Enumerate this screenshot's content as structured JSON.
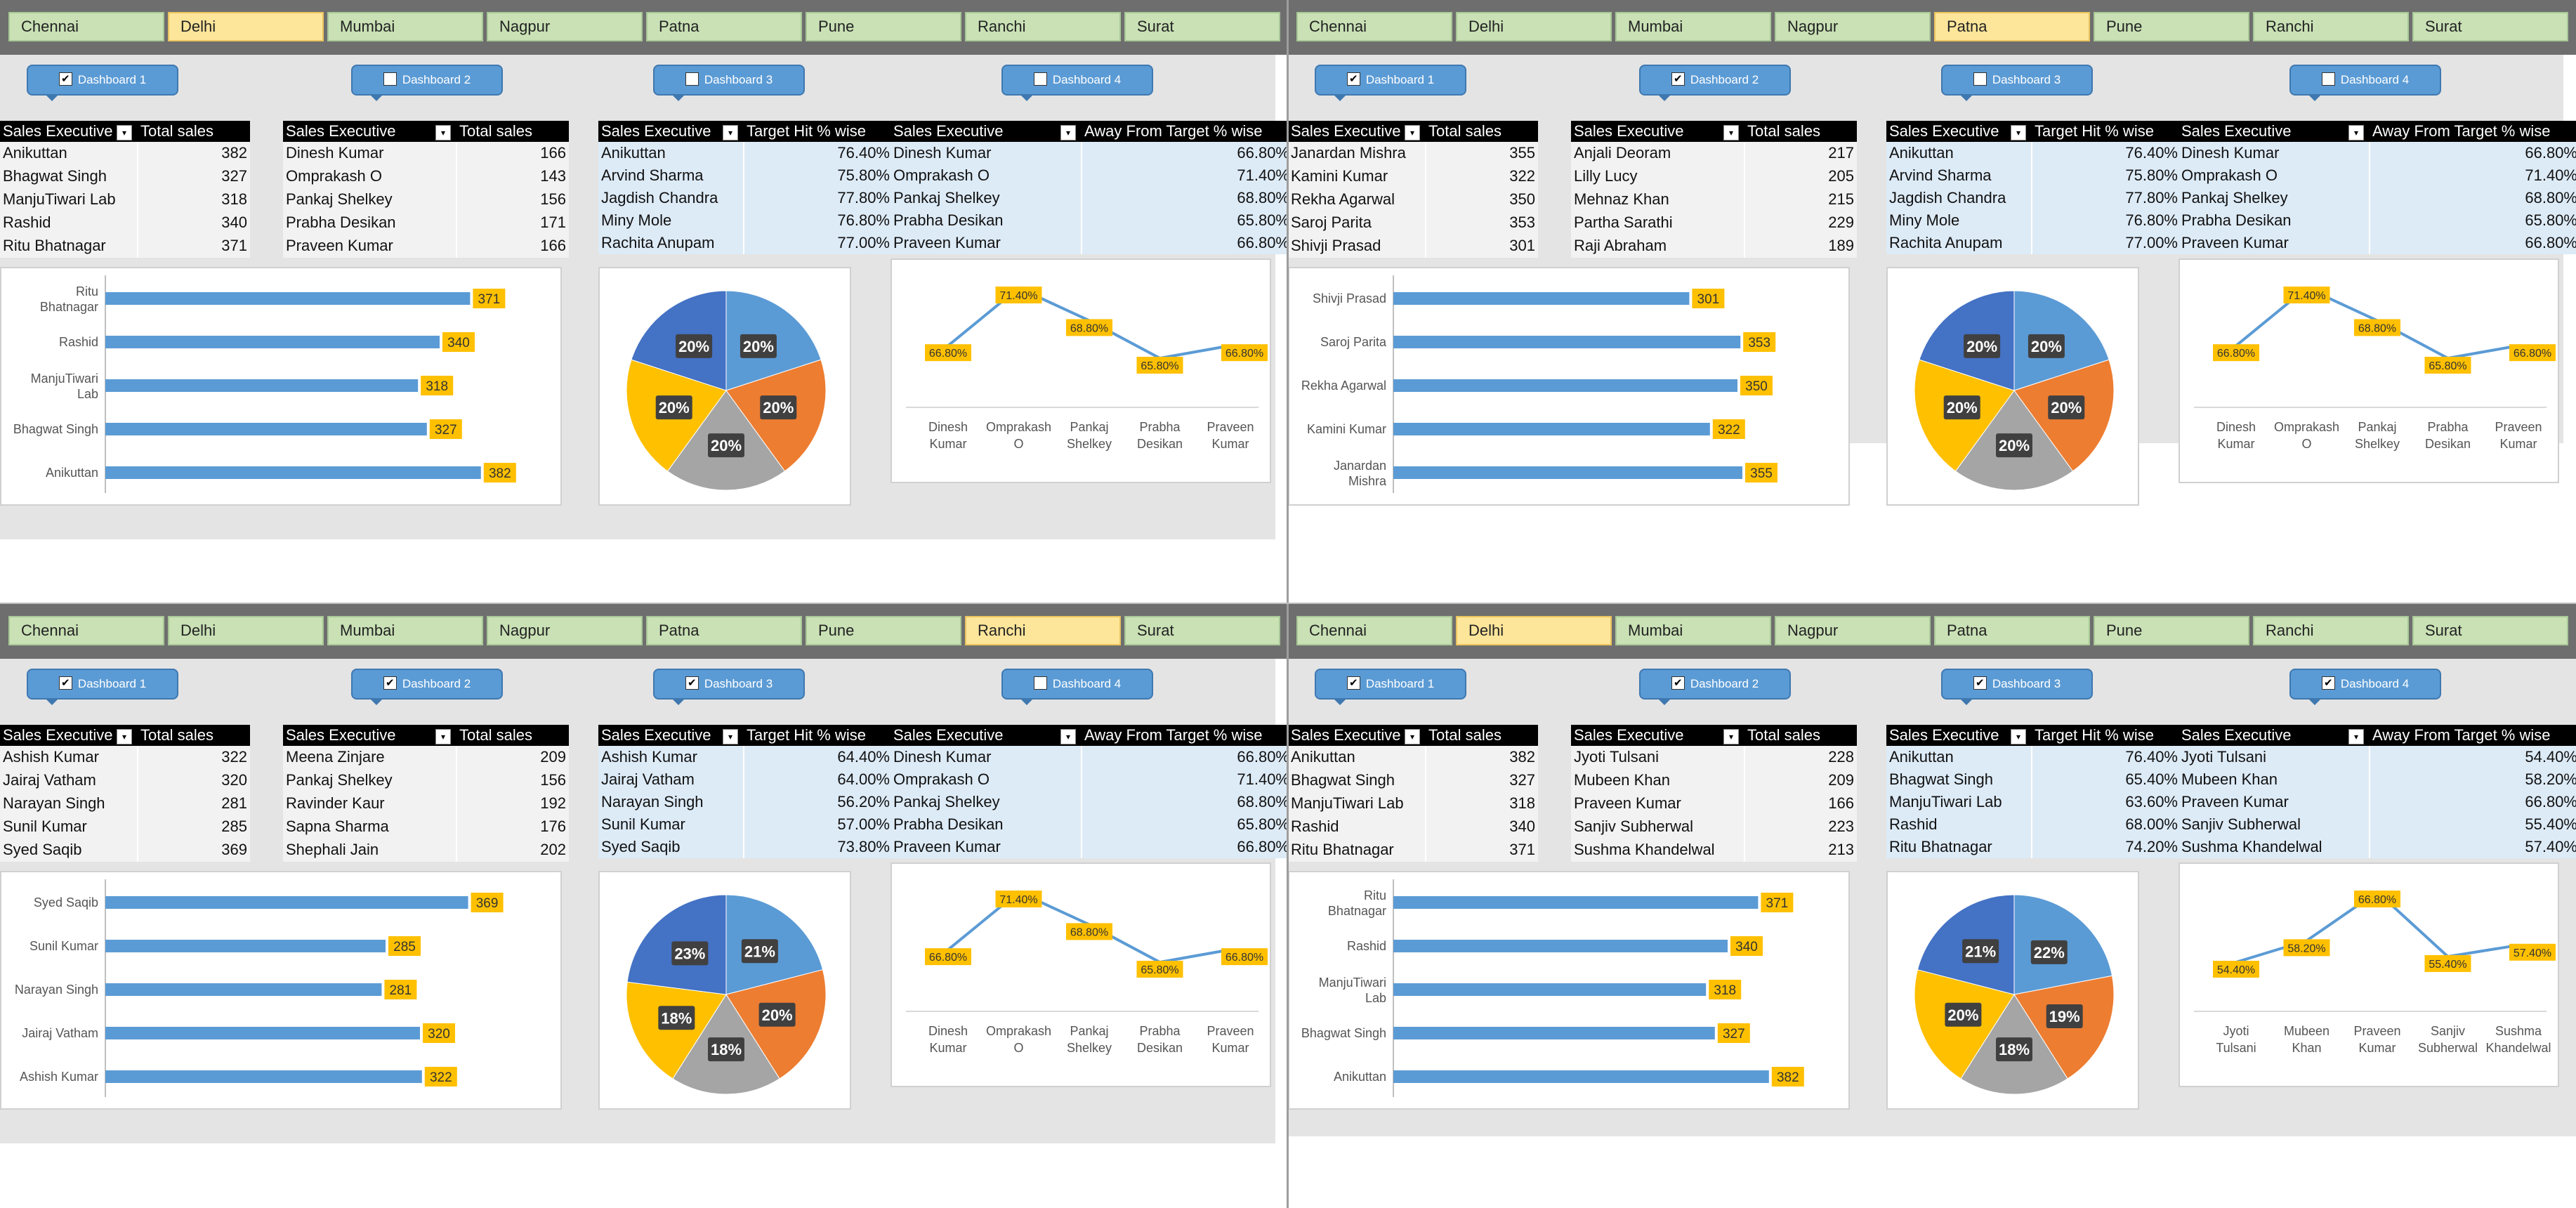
{
  "quadrants": [
    {
      "id": "q1",
      "cities": [
        "Chennai",
        "Delhi",
        "Mumbai",
        "Nagpur",
        "Patna",
        "Pune",
        "Ranchi",
        "Surat"
      ],
      "selected_city": "Delhi",
      "dashboards": [
        {
          "label": "Dashboard 1",
          "checked": true
        },
        {
          "label": "Dashboard 2",
          "checked": false
        },
        {
          "label": "Dashboard 3",
          "checked": false
        },
        {
          "label": "Dashboard 4",
          "checked": false
        }
      ],
      "tables": [
        {
          "h1": "Sales Executive",
          "h2": "Total sales",
          "rows": [
            [
              "Anikuttan",
              "382"
            ],
            [
              "Bhagwat Singh",
              "327"
            ],
            [
              "ManjuTiwari Lab",
              "318"
            ],
            [
              "Rashid",
              "340"
            ],
            [
              "Ritu Bhatnagar",
              "371"
            ]
          ]
        },
        {
          "h1": "Sales Executive",
          "h2": "Total sales",
          "rows": [
            [
              "Dinesh Kumar",
              "166"
            ],
            [
              "Omprakash O",
              "143"
            ],
            [
              "Pankaj Shelkey",
              "156"
            ],
            [
              "Prabha Desikan",
              "171"
            ],
            [
              "Praveen Kumar",
              "166"
            ]
          ]
        },
        {
          "h1": "Sales Executive",
          "h2": "Target Hit % wise",
          "rows": [
            [
              "Anikuttan",
              "76.40%"
            ],
            [
              "Arvind Sharma",
              "75.80%"
            ],
            [
              "Jagdish Chandra",
              "77.80%"
            ],
            [
              "Miny Mole",
              "76.80%"
            ],
            [
              "Rachita Anupam",
              "77.00%"
            ]
          ]
        },
        {
          "h1": "Sales Executive",
          "h2": "Away From Target % wise",
          "rows": [
            [
              "Dinesh Kumar",
              "66.80%"
            ],
            [
              "Omprakash O",
              "71.40%"
            ],
            [
              "Pankaj Shelkey",
              "68.80%"
            ],
            [
              "Prabha Desikan",
              "65.80%"
            ],
            [
              "Praveen Kumar",
              "66.80%"
            ]
          ]
        }
      ],
      "bar_chart": {
        "categories": [
          "Ritu Bhatnagar",
          "Rashid",
          "ManjuTiwari Lab",
          "Bhagwat Singh",
          "Anikuttan"
        ],
        "values": [
          371,
          340,
          318,
          327,
          382
        ]
      },
      "pie_chart": {
        "values": [
          20,
          20,
          20,
          20,
          20
        ],
        "labels": [
          "20%",
          "20%",
          "20%",
          "20%",
          "20%"
        ]
      },
      "line_chart": {
        "categories": [
          "Dinesh Kumar",
          "Omprakash O",
          "Pankaj Shelkey",
          "Prabha Desikan",
          "Praveen Kumar"
        ],
        "values": [
          66.8,
          71.4,
          68.8,
          65.8,
          66.8
        ],
        "labels": [
          "66.80%",
          "71.40%",
          "68.80%",
          "65.80%",
          "66.80%"
        ]
      }
    },
    {
      "id": "q2",
      "cities": [
        "Chennai",
        "Delhi",
        "Mumbai",
        "Nagpur",
        "Patna",
        "Pune",
        "Ranchi",
        "Surat"
      ],
      "selected_city": "Patna",
      "dashboards": [
        {
          "label": "Dashboard 1",
          "checked": true
        },
        {
          "label": "Dashboard 2",
          "checked": true
        },
        {
          "label": "Dashboard 3",
          "checked": false
        },
        {
          "label": "Dashboard 4",
          "checked": false
        }
      ],
      "tables": [
        {
          "h1": "Sales Executive",
          "h2": "Total sales",
          "rows": [
            [
              "Janardan Mishra",
              "355"
            ],
            [
              "Kamini Kumar",
              "322"
            ],
            [
              "Rekha Agarwal",
              "350"
            ],
            [
              "Saroj Parita",
              "353"
            ],
            [
              "Shivji Prasad",
              "301"
            ]
          ]
        },
        {
          "h1": "Sales Executive",
          "h2": "Total sales",
          "rows": [
            [
              "Anjali Deoram",
              "217"
            ],
            [
              "Lilly Lucy",
              "205"
            ],
            [
              "Mehnaz Khan",
              "215"
            ],
            [
              "Partha Sarathi",
              "229"
            ],
            [
              "Raji Abraham",
              "189"
            ]
          ]
        },
        {
          "h1": "Sales Executive",
          "h2": "Target Hit % wise",
          "rows": [
            [
              "Anikuttan",
              "76.40%"
            ],
            [
              "Arvind Sharma",
              "75.80%"
            ],
            [
              "Jagdish Chandra",
              "77.80%"
            ],
            [
              "Miny Mole",
              "76.80%"
            ],
            [
              "Rachita Anupam",
              "77.00%"
            ]
          ]
        },
        {
          "h1": "Sales Executive",
          "h2": "Away From Target % wise",
          "rows": [
            [
              "Dinesh Kumar",
              "66.80%"
            ],
            [
              "Omprakash O",
              "71.40%"
            ],
            [
              "Pankaj Shelkey",
              "68.80%"
            ],
            [
              "Prabha Desikan",
              "65.80%"
            ],
            [
              "Praveen Kumar",
              "66.80%"
            ]
          ]
        }
      ],
      "bar_chart": {
        "categories": [
          "Shivji Prasad",
          "Saroj Parita",
          "Rekha Agarwal",
          "Kamini Kumar",
          "Janardan Mishra"
        ],
        "values": [
          301,
          353,
          350,
          322,
          355
        ]
      },
      "pie_chart": {
        "values": [
          20,
          20,
          20,
          20,
          20
        ],
        "labels": [
          "20%",
          "20%",
          "20%",
          "20%",
          "20%"
        ]
      },
      "line_chart": {
        "categories": [
          "Dinesh Kumar",
          "Omprakash O",
          "Pankaj Shelkey",
          "Prabha Desikan",
          "Praveen Kumar"
        ],
        "values": [
          66.8,
          71.4,
          68.8,
          65.8,
          66.8
        ],
        "labels": [
          "66.80%",
          "71.40%",
          "68.80%",
          "65.80%",
          "66.80%"
        ]
      }
    },
    {
      "id": "q3",
      "cities": [
        "Chennai",
        "Delhi",
        "Mumbai",
        "Nagpur",
        "Patna",
        "Pune",
        "Ranchi",
        "Surat"
      ],
      "selected_city": "Ranchi",
      "dashboards": [
        {
          "label": "Dashboard 1",
          "checked": true
        },
        {
          "label": "Dashboard 2",
          "checked": true
        },
        {
          "label": "Dashboard 3",
          "checked": true
        },
        {
          "label": "Dashboard 4",
          "checked": false
        }
      ],
      "tables": [
        {
          "h1": "Sales Executive",
          "h2": "Total sales",
          "rows": [
            [
              "Ashish Kumar",
              "322"
            ],
            [
              "Jairaj Vatham",
              "320"
            ],
            [
              "Narayan Singh",
              "281"
            ],
            [
              "Sunil Kumar",
              "285"
            ],
            [
              "Syed Saqib",
              "369"
            ]
          ]
        },
        {
          "h1": "Sales Executive",
          "h2": "Total sales",
          "rows": [
            [
              "Meena Zinjare",
              "209"
            ],
            [
              "Pankaj Shelkey",
              "156"
            ],
            [
              "Ravinder Kaur",
              "192"
            ],
            [
              "Sapna Sharma",
              "176"
            ],
            [
              "Shephali Jain",
              "202"
            ]
          ]
        },
        {
          "h1": "Sales Executive",
          "h2": "Target Hit % wise",
          "rows": [
            [
              "Ashish Kumar",
              "64.40%"
            ],
            [
              "Jairaj Vatham",
              "64.00%"
            ],
            [
              "Narayan Singh",
              "56.20%"
            ],
            [
              "Sunil Kumar",
              "57.00%"
            ],
            [
              "Syed Saqib",
              "73.80%"
            ]
          ]
        },
        {
          "h1": "Sales Executive",
          "h2": "Away From Target % wise",
          "rows": [
            [
              "Dinesh Kumar",
              "66.80%"
            ],
            [
              "Omprakash O",
              "71.40%"
            ],
            [
              "Pankaj Shelkey",
              "68.80%"
            ],
            [
              "Prabha Desikan",
              "65.80%"
            ],
            [
              "Praveen Kumar",
              "66.80%"
            ]
          ]
        }
      ],
      "bar_chart": {
        "categories": [
          "Syed Saqib",
          "Sunil Kumar",
          "Narayan Singh",
          "Jairaj Vatham",
          "Ashish Kumar"
        ],
        "values": [
          369,
          285,
          281,
          320,
          322
        ]
      },
      "pie_chart": {
        "values": [
          21,
          20,
          18,
          18,
          23
        ],
        "labels": [
          "21%",
          "20%",
          "18%",
          "18%",
          "23%"
        ]
      },
      "line_chart": {
        "categories": [
          "Dinesh Kumar",
          "Omprakash O",
          "Pankaj Shelkey",
          "Prabha Desikan",
          "Praveen Kumar"
        ],
        "values": [
          66.8,
          71.4,
          68.8,
          65.8,
          66.8
        ],
        "labels": [
          "66.80%",
          "71.40%",
          "68.80%",
          "65.80%",
          "66.80%"
        ]
      }
    },
    {
      "id": "q4",
      "cities": [
        "Chennai",
        "Delhi",
        "Mumbai",
        "Nagpur",
        "Patna",
        "Pune",
        "Ranchi",
        "Surat"
      ],
      "selected_city": "Delhi",
      "dashboards": [
        {
          "label": "Dashboard 1",
          "checked": true
        },
        {
          "label": "Dashboard 2",
          "checked": true
        },
        {
          "label": "Dashboard 3",
          "checked": true
        },
        {
          "label": "Dashboard 4",
          "checked": true
        }
      ],
      "tables": [
        {
          "h1": "Sales Executive",
          "h2": "Total sales",
          "rows": [
            [
              "Anikuttan",
              "382"
            ],
            [
              "Bhagwat Singh",
              "327"
            ],
            [
              "ManjuTiwari Lab",
              "318"
            ],
            [
              "Rashid",
              "340"
            ],
            [
              "Ritu Bhatnagar",
              "371"
            ]
          ]
        },
        {
          "h1": "Sales Executive",
          "h2": "Total sales",
          "rows": [
            [
              "Jyoti Tulsani",
              "228"
            ],
            [
              "Mubeen Khan",
              "209"
            ],
            [
              "Praveen Kumar",
              "166"
            ],
            [
              "Sanjiv Subherwal",
              "223"
            ],
            [
              "Sushma Khandelwal",
              "213"
            ]
          ]
        },
        {
          "h1": "Sales Executive",
          "h2": "Target Hit % wise",
          "rows": [
            [
              "Anikuttan",
              "76.40%"
            ],
            [
              "Bhagwat Singh",
              "65.40%"
            ],
            [
              "ManjuTiwari Lab",
              "63.60%"
            ],
            [
              "Rashid",
              "68.00%"
            ],
            [
              "Ritu Bhatnagar",
              "74.20%"
            ]
          ]
        },
        {
          "h1": "Sales Executive",
          "h2": "Away From Target % wise",
          "rows": [
            [
              "Jyoti Tulsani",
              "54.40%"
            ],
            [
              "Mubeen Khan",
              "58.20%"
            ],
            [
              "Praveen Kumar",
              "66.80%"
            ],
            [
              "Sanjiv Subherwal",
              "55.40%"
            ],
            [
              "Sushma Khandelwal",
              "57.40%"
            ]
          ]
        }
      ],
      "bar_chart": {
        "categories": [
          "Ritu Bhatnagar",
          "Rashid",
          "ManjuTiwari Lab",
          "Bhagwat Singh",
          "Anikuttan"
        ],
        "values": [
          371,
          340,
          318,
          327,
          382
        ]
      },
      "pie_chart": {
        "values": [
          22,
          19,
          18,
          20,
          21
        ],
        "labels": [
          "22%",
          "19%",
          "18%",
          "20%",
          "21%"
        ]
      },
      "line_chart": {
        "categories": [
          "Jyoti Tulsani",
          "Mubeen Khan",
          "Praveen Kumar",
          "Sanjiv Subherwal",
          "Sushma Khandelwal"
        ],
        "values": [
          54.4,
          58.2,
          66.8,
          55.4,
          57.4
        ],
        "labels": [
          "54.40%",
          "58.20%",
          "66.80%",
          "55.40%",
          "57.40%"
        ]
      }
    }
  ],
  "colors": {
    "slicer": "#c9e1b5",
    "slicer_selected": "#fde59a",
    "button": "#5b9bd5",
    "bar": "#5b9bd5",
    "label_bg": "#ffc000",
    "line": "#5b9bd5",
    "pie": [
      "#5b9bd5",
      "#ed7d31",
      "#a5a5a5",
      "#ffc000",
      "#4472c4"
    ]
  },
  "chart_data": [
    {
      "type": "bar",
      "categories": [
        "Ritu Bhatnagar",
        "Rashid",
        "ManjuTiwari Lab",
        "Bhagwat Singh",
        "Anikuttan"
      ],
      "values": [
        371,
        340,
        318,
        327,
        382
      ]
    },
    {
      "type": "pie",
      "categories": [
        "20%",
        "20%",
        "20%",
        "20%",
        "20%"
      ],
      "values": [
        20,
        20,
        20,
        20,
        20
      ]
    },
    {
      "type": "line",
      "categories": [
        "Dinesh Kumar",
        "Omprakash O",
        "Pankaj Shelkey",
        "Prabha Desikan",
        "Praveen Kumar"
      ],
      "values": [
        66.8,
        71.4,
        68.8,
        65.8,
        66.8
      ]
    },
    {
      "type": "bar",
      "categories": [
        "Shivji Prasad",
        "Saroj Parita",
        "Rekha Agarwal",
        "Kamini Kumar",
        "Janardan Mishra"
      ],
      "values": [
        301,
        353,
        350,
        322,
        355
      ]
    },
    {
      "type": "pie",
      "categories": [
        "20%",
        "20%",
        "20%",
        "20%",
        "20%"
      ],
      "values": [
        20,
        20,
        20,
        20,
        20
      ]
    },
    {
      "type": "line",
      "categories": [
        "Dinesh Kumar",
        "Omprakash O",
        "Pankaj Shelkey",
        "Prabha Desikan",
        "Praveen Kumar"
      ],
      "values": [
        66.8,
        71.4,
        68.8,
        65.8,
        66.8
      ]
    },
    {
      "type": "bar",
      "categories": [
        "Syed Saqib",
        "Sunil Kumar",
        "Narayan Singh",
        "Jairaj Vatham",
        "Ashish Kumar"
      ],
      "values": [
        369,
        285,
        281,
        320,
        322
      ]
    },
    {
      "type": "pie",
      "categories": [
        "21%",
        "20%",
        "18%",
        "18%",
        "23%"
      ],
      "values": [
        21,
        20,
        18,
        18,
        23
      ]
    },
    {
      "type": "line",
      "categories": [
        "Dinesh Kumar",
        "Omprakash O",
        "Pankaj Shelkey",
        "Prabha Desikan",
        "Praveen Kumar"
      ],
      "values": [
        66.8,
        71.4,
        68.8,
        65.8,
        66.8
      ]
    },
    {
      "type": "bar",
      "categories": [
        "Ritu Bhatnagar",
        "Rashid",
        "ManjuTiwari Lab",
        "Bhagwat Singh",
        "Anikuttan"
      ],
      "values": [
        371,
        340,
        318,
        327,
        382
      ]
    },
    {
      "type": "pie",
      "categories": [
        "22%",
        "19%",
        "18%",
        "20%",
        "21%"
      ],
      "values": [
        22,
        19,
        18,
        20,
        21
      ]
    },
    {
      "type": "line",
      "categories": [
        "Jyoti Tulsani",
        "Mubeen Khan",
        "Praveen Kumar",
        "Sanjiv Subherwal",
        "Sushma Khandelwal"
      ],
      "values": [
        54.4,
        58.2,
        66.8,
        55.4,
        57.4
      ]
    }
  ]
}
